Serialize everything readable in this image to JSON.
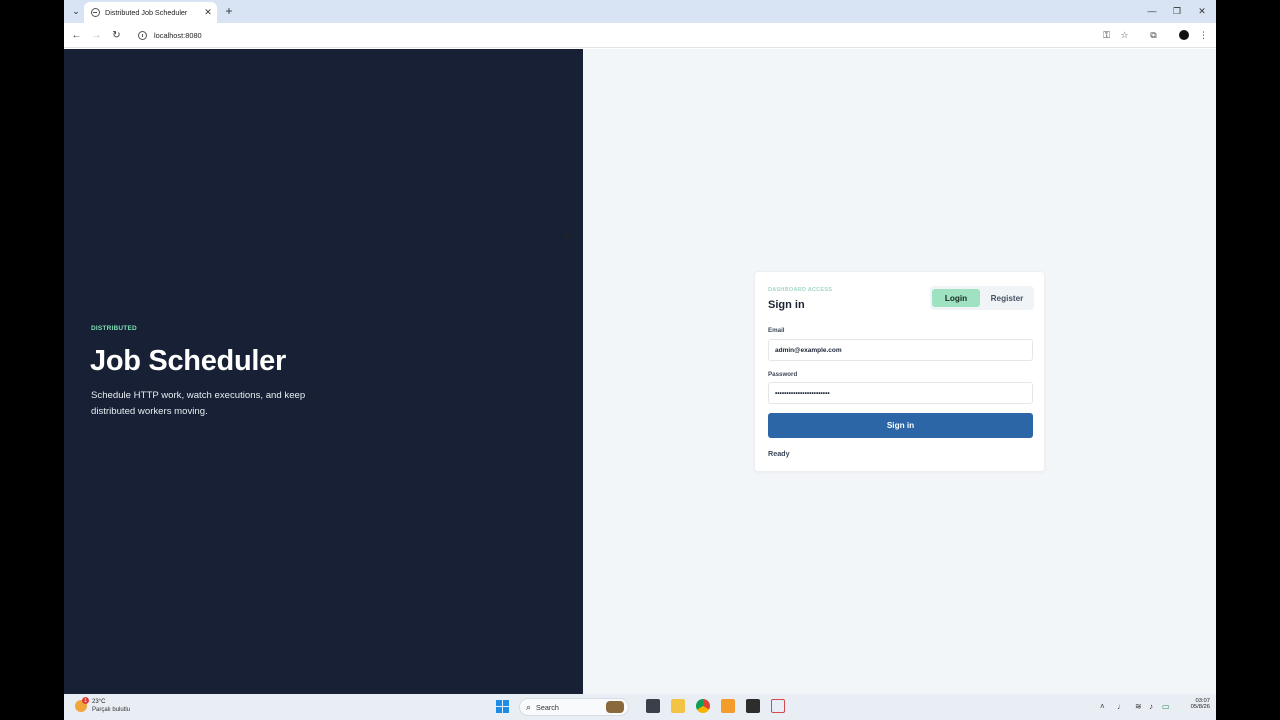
{
  "browser": {
    "tab_title": "Distributed Job Scheduler",
    "url": "localhost:8080",
    "icons": [
      "back-icon",
      "forward-icon",
      "reload-icon",
      "site-info-icon",
      "password-key-icon",
      "bookmark-star-icon",
      "extensions-icon",
      "profile-avatar-icon",
      "more-menu-icon"
    ]
  },
  "hero": {
    "eyebrow": "DISTRIBUTED",
    "title": "Job Scheduler",
    "description": "Schedule HTTP work, watch executions, and keep distributed workers moving."
  },
  "auth": {
    "eyebrow": "DASHBOARD ACCESS",
    "title": "Sign in",
    "tabs": {
      "login": "Login",
      "register": "Register",
      "active": "Login"
    },
    "email_label": "Email",
    "email_value": "admin@example.com",
    "password_label": "Password",
    "password_value": "••••••••••••••••••••••••",
    "submit_label": "Sign in",
    "status": "Ready",
    "colors": {
      "accent": "#2c66a7",
      "active_tab": "#9ee2c1",
      "hero_bg": "#172034",
      "eyebrow": "#7fe0b4"
    }
  },
  "taskbar": {
    "weather_temp": "23°C",
    "weather_desc": "Parçalı bulutlu",
    "weather_badge": "1",
    "search_placeholder": "Search",
    "clock_time": "03:07",
    "clock_date": "05/8/26"
  }
}
